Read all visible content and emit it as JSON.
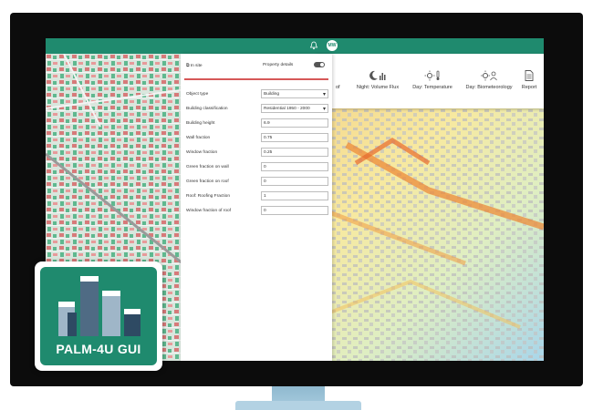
{
  "app": {
    "logo_text": "PALM-4U GUI",
    "user_initials": "MW",
    "accent_color": "#1f8a6e",
    "icons": [
      "bell-icon",
      "moon-bars-icon",
      "sun-thermometer-icon",
      "sun-person-icon",
      "document-icon"
    ]
  },
  "toolbar": {
    "partial_label": "of",
    "items": [
      {
        "label": "Night: Volume Flux",
        "icon": "moon-bars-icon"
      },
      {
        "label": "Day: Temperature",
        "icon": "sun-thermometer-icon"
      },
      {
        "label": "Day: Biometeorology",
        "icon": "sun-person-icon"
      },
      {
        "label": "Report",
        "icon": "document-icon"
      }
    ]
  },
  "panel": {
    "tab1": "In site",
    "tab2": "Property details",
    "fields": [
      {
        "label": "Object type",
        "value": "Building",
        "type": "select"
      },
      {
        "label": "Building classification",
        "value": "Residential 1950 - 2000",
        "type": "select"
      },
      {
        "label": "Building height",
        "value": "6.9",
        "type": "input"
      },
      {
        "label": "Wall fraction",
        "value": "0.75",
        "type": "input"
      },
      {
        "label": "Window fraction",
        "value": "0.25",
        "type": "input"
      },
      {
        "label": "Green fraction on wall",
        "value": "0",
        "type": "input"
      },
      {
        "label": "Green fraction on roof",
        "value": "0",
        "type": "input"
      },
      {
        "label": "Roof: Roofing Fraction",
        "value": "1",
        "type": "input"
      },
      {
        "label": "Window fraction of roof",
        "value": "0",
        "type": "input"
      }
    ]
  }
}
